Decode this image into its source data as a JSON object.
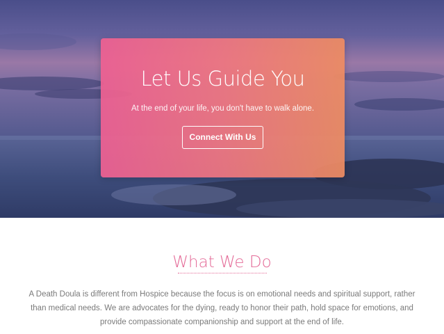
{
  "hero": {
    "title": "Let Us Guide You",
    "subtitle": "At the end of your life, you don't have to walk alone.",
    "button_label": "Connect With Us",
    "gradient_start": "#ee6092",
    "gradient_end": "#ee8c62"
  },
  "what_we_do": {
    "title": "What We Do",
    "title_color": "#e46a97",
    "body": "A Death Doula is different from Hospice because the focus is on emotional needs and spiritual support, rather than medical needs. We are advocates for the dying, ready to honor their path, hold space for emotions, and provide compassionate companionship and support at the end of life."
  }
}
